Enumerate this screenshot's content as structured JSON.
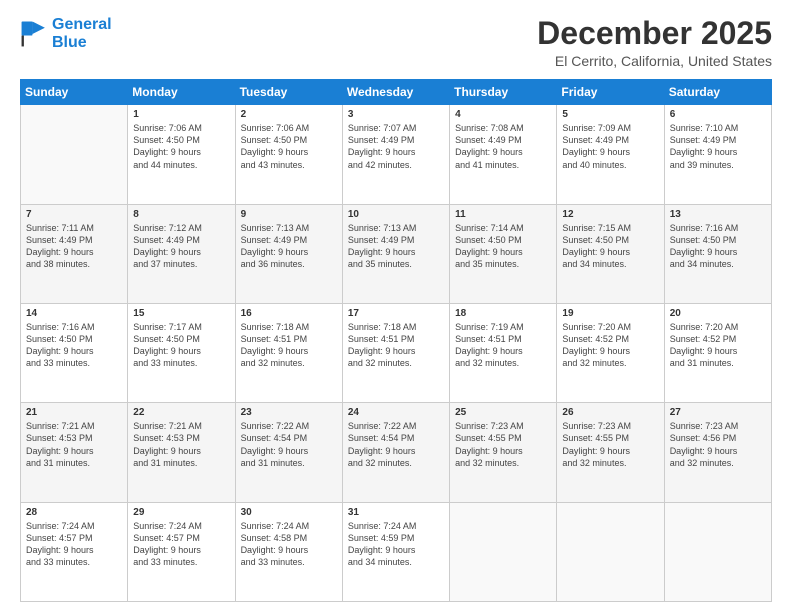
{
  "logo": {
    "line1": "General",
    "line2": "Blue"
  },
  "title": "December 2025",
  "subtitle": "El Cerrito, California, United States",
  "days_header": [
    "Sunday",
    "Monday",
    "Tuesday",
    "Wednesday",
    "Thursday",
    "Friday",
    "Saturday"
  ],
  "weeks": [
    [
      {
        "num": "",
        "info": ""
      },
      {
        "num": "1",
        "info": "Sunrise: 7:06 AM\nSunset: 4:50 PM\nDaylight: 9 hours\nand 44 minutes."
      },
      {
        "num": "2",
        "info": "Sunrise: 7:06 AM\nSunset: 4:50 PM\nDaylight: 9 hours\nand 43 minutes."
      },
      {
        "num": "3",
        "info": "Sunrise: 7:07 AM\nSunset: 4:49 PM\nDaylight: 9 hours\nand 42 minutes."
      },
      {
        "num": "4",
        "info": "Sunrise: 7:08 AM\nSunset: 4:49 PM\nDaylight: 9 hours\nand 41 minutes."
      },
      {
        "num": "5",
        "info": "Sunrise: 7:09 AM\nSunset: 4:49 PM\nDaylight: 9 hours\nand 40 minutes."
      },
      {
        "num": "6",
        "info": "Sunrise: 7:10 AM\nSunset: 4:49 PM\nDaylight: 9 hours\nand 39 minutes."
      }
    ],
    [
      {
        "num": "7",
        "info": "Sunrise: 7:11 AM\nSunset: 4:49 PM\nDaylight: 9 hours\nand 38 minutes."
      },
      {
        "num": "8",
        "info": "Sunrise: 7:12 AM\nSunset: 4:49 PM\nDaylight: 9 hours\nand 37 minutes."
      },
      {
        "num": "9",
        "info": "Sunrise: 7:13 AM\nSunset: 4:49 PM\nDaylight: 9 hours\nand 36 minutes."
      },
      {
        "num": "10",
        "info": "Sunrise: 7:13 AM\nSunset: 4:49 PM\nDaylight: 9 hours\nand 35 minutes."
      },
      {
        "num": "11",
        "info": "Sunrise: 7:14 AM\nSunset: 4:50 PM\nDaylight: 9 hours\nand 35 minutes."
      },
      {
        "num": "12",
        "info": "Sunrise: 7:15 AM\nSunset: 4:50 PM\nDaylight: 9 hours\nand 34 minutes."
      },
      {
        "num": "13",
        "info": "Sunrise: 7:16 AM\nSunset: 4:50 PM\nDaylight: 9 hours\nand 34 minutes."
      }
    ],
    [
      {
        "num": "14",
        "info": "Sunrise: 7:16 AM\nSunset: 4:50 PM\nDaylight: 9 hours\nand 33 minutes."
      },
      {
        "num": "15",
        "info": "Sunrise: 7:17 AM\nSunset: 4:50 PM\nDaylight: 9 hours\nand 33 minutes."
      },
      {
        "num": "16",
        "info": "Sunrise: 7:18 AM\nSunset: 4:51 PM\nDaylight: 9 hours\nand 32 minutes."
      },
      {
        "num": "17",
        "info": "Sunrise: 7:18 AM\nSunset: 4:51 PM\nDaylight: 9 hours\nand 32 minutes."
      },
      {
        "num": "18",
        "info": "Sunrise: 7:19 AM\nSunset: 4:51 PM\nDaylight: 9 hours\nand 32 minutes."
      },
      {
        "num": "19",
        "info": "Sunrise: 7:20 AM\nSunset: 4:52 PM\nDaylight: 9 hours\nand 32 minutes."
      },
      {
        "num": "20",
        "info": "Sunrise: 7:20 AM\nSunset: 4:52 PM\nDaylight: 9 hours\nand 31 minutes."
      }
    ],
    [
      {
        "num": "21",
        "info": "Sunrise: 7:21 AM\nSunset: 4:53 PM\nDaylight: 9 hours\nand 31 minutes."
      },
      {
        "num": "22",
        "info": "Sunrise: 7:21 AM\nSunset: 4:53 PM\nDaylight: 9 hours\nand 31 minutes."
      },
      {
        "num": "23",
        "info": "Sunrise: 7:22 AM\nSunset: 4:54 PM\nDaylight: 9 hours\nand 31 minutes."
      },
      {
        "num": "24",
        "info": "Sunrise: 7:22 AM\nSunset: 4:54 PM\nDaylight: 9 hours\nand 32 minutes."
      },
      {
        "num": "25",
        "info": "Sunrise: 7:23 AM\nSunset: 4:55 PM\nDaylight: 9 hours\nand 32 minutes."
      },
      {
        "num": "26",
        "info": "Sunrise: 7:23 AM\nSunset: 4:55 PM\nDaylight: 9 hours\nand 32 minutes."
      },
      {
        "num": "27",
        "info": "Sunrise: 7:23 AM\nSunset: 4:56 PM\nDaylight: 9 hours\nand 32 minutes."
      }
    ],
    [
      {
        "num": "28",
        "info": "Sunrise: 7:24 AM\nSunset: 4:57 PM\nDaylight: 9 hours\nand 33 minutes."
      },
      {
        "num": "29",
        "info": "Sunrise: 7:24 AM\nSunset: 4:57 PM\nDaylight: 9 hours\nand 33 minutes."
      },
      {
        "num": "30",
        "info": "Sunrise: 7:24 AM\nSunset: 4:58 PM\nDaylight: 9 hours\nand 33 minutes."
      },
      {
        "num": "31",
        "info": "Sunrise: 7:24 AM\nSunset: 4:59 PM\nDaylight: 9 hours\nand 34 minutes."
      },
      {
        "num": "",
        "info": ""
      },
      {
        "num": "",
        "info": ""
      },
      {
        "num": "",
        "info": ""
      }
    ]
  ]
}
